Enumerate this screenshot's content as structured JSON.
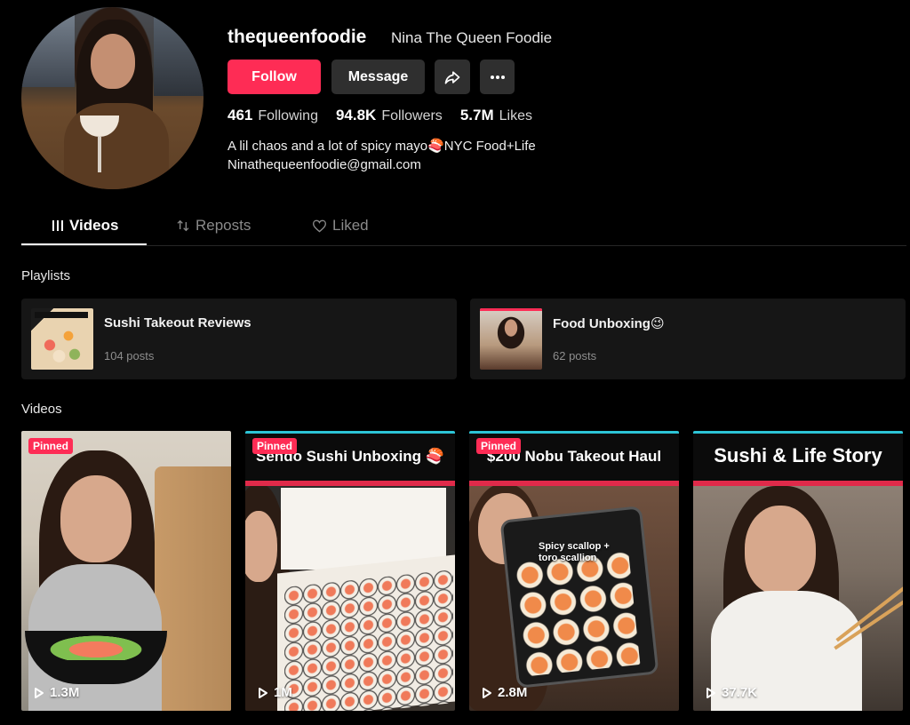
{
  "profile": {
    "handle": "thequeenfoodie",
    "display_name": "Nina The Queen Foodie",
    "follow_label": "Follow",
    "message_label": "Message",
    "stats": {
      "following_count": "461",
      "following_label": "Following",
      "followers_count": "94.8K",
      "followers_label": "Followers",
      "likes_count": "5.7M",
      "likes_label": "Likes"
    },
    "bio_line1": "A lil chaos and a lot of spicy mayo🍣NYC Food+Life",
    "bio_line2": "Ninathequeenfoodie@gmail.com"
  },
  "tabs": [
    {
      "label": "Videos",
      "active": true,
      "icon": "grid-bars-icon"
    },
    {
      "label": "Reposts",
      "active": false,
      "icon": "repost-icon"
    },
    {
      "label": "Liked",
      "active": false,
      "icon": "heart-outline-icon"
    }
  ],
  "playlists_title": "Playlists",
  "playlists": [
    {
      "name": "Sushi Takeout Reviews",
      "count": "104 posts"
    },
    {
      "name": "Food Unboxing😉",
      "count": "62 posts"
    }
  ],
  "videos_title": "Videos",
  "videos": [
    {
      "pinned": "Pinned",
      "caption": "",
      "views": "1.3M"
    },
    {
      "pinned": "Pinned",
      "caption": "Sendo Sushi Unboxing 🍣",
      "views": "1M"
    },
    {
      "pinned": "Pinned",
      "caption": "$200 Nobu Takeout Haul",
      "views": "2.8M",
      "overlay": "Spicy scallop + toro scallion"
    },
    {
      "pinned": "",
      "caption": "Sushi & Life Story",
      "views": "37.7K"
    }
  ],
  "colors": {
    "accent": "#fe2c55",
    "background": "#000000",
    "button_dark": "#2f2f2f",
    "card": "#161616"
  }
}
